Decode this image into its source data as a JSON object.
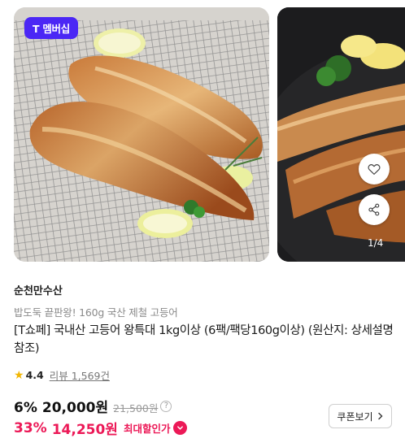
{
  "membership_badge": "T 멤버십",
  "carousel": {
    "pager": "1/4"
  },
  "product": {
    "seller": "순천만수산",
    "subtitle": "밥도둑 끝판왕! 160g  국산 제철 고등어",
    "title": "[T쇼페] 국내산 고등어 왕특대 1kg이상 (6팩/팩당160g이상) (원산지: 상세설명 참조)",
    "rating": "4.4",
    "reviews": "리뷰 1,569건"
  },
  "price": {
    "discount_rate": "6%",
    "sale_price": "20,000원",
    "original_price": "21,500원",
    "help_glyph": "?",
    "max_discount_rate": "33%",
    "max_discount_price": "14,250원",
    "max_discount_label": "최대할인가"
  },
  "coupon_button": "쿠폰보기",
  "colors": {
    "badge": "#4b27f5",
    "discount": "#ec1957",
    "star": "#f2b705"
  },
  "icons": [
    "heart-icon",
    "share-icon",
    "star-icon",
    "help-icon",
    "chevron-down-icon",
    "chevron-right-icon"
  ]
}
